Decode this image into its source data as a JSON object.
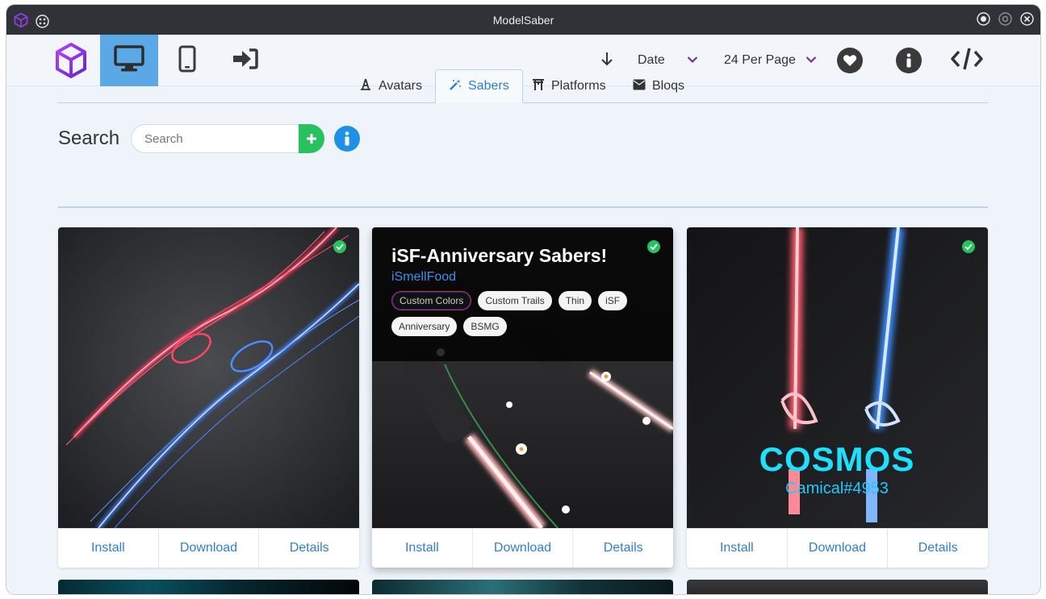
{
  "window": {
    "title": "ModelSaber"
  },
  "nav": {
    "sort_field": "Date",
    "per_page": "24 Per Page"
  },
  "tabs": [
    {
      "label": "Avatars"
    },
    {
      "label": "Sabers"
    },
    {
      "label": "Platforms"
    },
    {
      "label": "Bloqs"
    }
  ],
  "search": {
    "title": "Search",
    "placeholder": "Search"
  },
  "cards": [
    {
      "install": "Install",
      "download": "Download",
      "details": "Details"
    },
    {
      "title": "iSF-Anniversary Sabers!",
      "author": "iSmellFood",
      "tags": [
        "Custom Colors",
        "Custom Trails",
        "Thin",
        "iSF",
        "Anniversary",
        "BSMG"
      ],
      "install": "Install",
      "download": "Download",
      "details": "Details"
    },
    {
      "image_text": "COSMOS",
      "image_subtext": "Camical#4953",
      "install": "Install",
      "download": "Download",
      "details": "Details"
    }
  ],
  "colors": {
    "accent": "#5aa9e6",
    "link": "#2f7fd0",
    "approved": "#27c25e",
    "brand": "#8a2be2"
  }
}
